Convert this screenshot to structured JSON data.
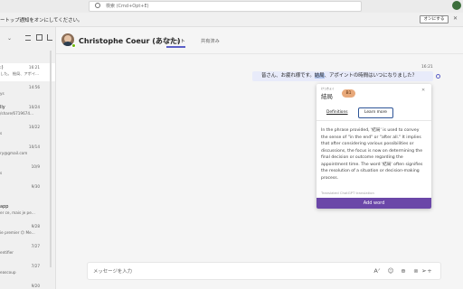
{
  "app": {
    "search_placeholder": "検索 (Cmd+Opt+E)"
  },
  "notification": {
    "text": "ートップ通知をオンにしてください。",
    "button": "オンにする",
    "close": "✕"
  },
  "sidebar": {
    "icons": [
      "chevron-down-icon",
      "filter-icon",
      "video-icon",
      "compose-icon"
    ],
    "chats": [
      {
        "name": ":)",
        "time": "16:21",
        "snippet": "した。 絵局、アポイ..."
      },
      {
        "name": "",
        "time": "14:56",
        "snippet": "ys"
      },
      {
        "name": "lly",
        "time": "10/24",
        "snippet": "/share/6719674..."
      },
      {
        "name": "",
        "time": "10/22",
        "snippet": "s"
      },
      {
        "name": "",
        "time": "10/14",
        "snippet": "ry@gmail.com"
      },
      {
        "name": "",
        "time": "10/9",
        "snippet": "s"
      },
      {
        "name": "",
        "time": "9/30",
        "snippet": ""
      },
      {
        "name": "app",
        "time": "",
        "snippet": "er ce, mais je pe..."
      },
      {
        "name": "",
        "time": "9/28",
        "snippet": "ie premier 😊 Me..."
      },
      {
        "name": "",
        "time": "7/27",
        "snippet": "entifier"
      },
      {
        "name": "",
        "time": "7/27",
        "snippet": "eascoup"
      },
      {
        "name": "",
        "time": "9/20",
        "snippet": "mail couper la p..."
      }
    ]
  },
  "chat": {
    "contact_name": "Christophe Coeur (あなた)",
    "tabs": [
      {
        "label": "チャット",
        "active": true
      },
      {
        "label": "共有済み",
        "active": false
      }
    ],
    "message": {
      "time": "16:21",
      "text_before": "皆さん、お疲れ様です。",
      "highlight": "結局",
      "text_after": "、アポイントの時間はいつになりました？"
    }
  },
  "popup": {
    "ruby": "けっきょく",
    "word": "結局",
    "level": "B1",
    "close": "✕",
    "definitions_label": "Definitions",
    "learn_more_label": "Learn more",
    "body": "In the phrase provided, '結局' is used to convey the sense of \"in the end\" or \"after all.\" It implies that after considering various possibilities or discussions, the focus is now on determining the final decision or outcome regarding the appointment time. The word '結局' often signifies the resolution of a situation or decision-making process.",
    "source": "Translated ChatGPT translation",
    "add_word_label": "Add word"
  },
  "composer": {
    "placeholder": "メッセージを入力",
    "icons": [
      "format-icon",
      "emoji-icon",
      "attach-icon",
      "loop-icon",
      "add-icon",
      "send-icon"
    ]
  },
  "colors": {
    "accent": "#5b5fc7",
    "bubble": "#e8ebfa",
    "add_button": "#6b47a8",
    "level_badge": "#e8a97a"
  }
}
